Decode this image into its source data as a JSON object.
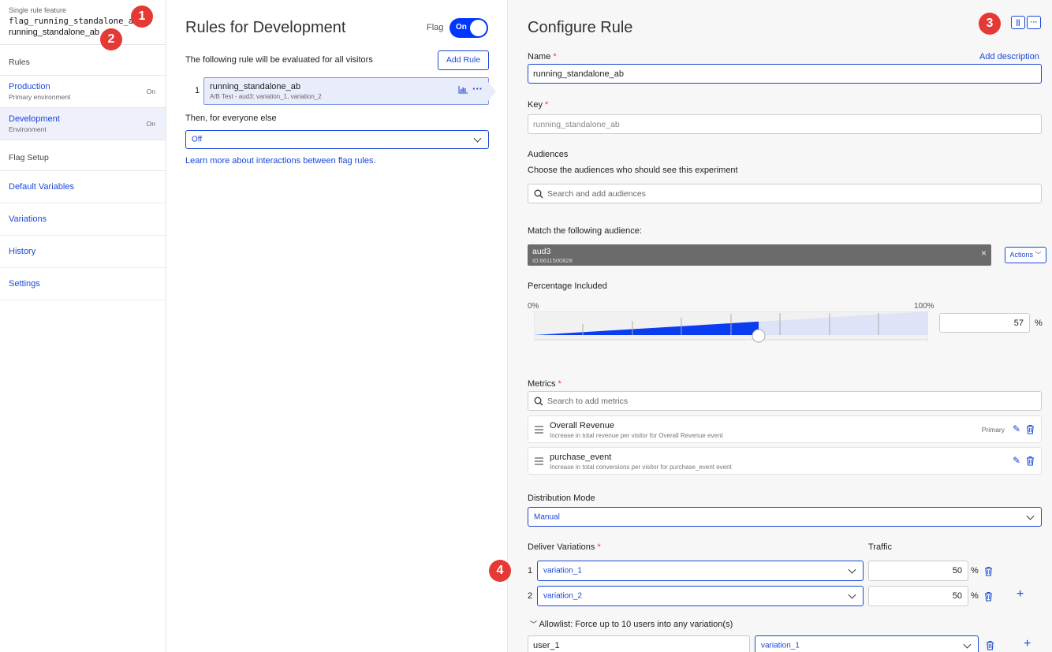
{
  "sidebar": {
    "feature_label": "Single rule feature",
    "flag_key": "flag_running_standalone_ab",
    "rule_name": "running_standalone_ab",
    "rules_heading": "Rules",
    "environments": [
      {
        "name": "Production",
        "sub": "Primary environment",
        "status": "On"
      },
      {
        "name": "Development",
        "sub": "Environment",
        "status": "On"
      }
    ],
    "setup_heading": "Flag Setup",
    "links": [
      "Default Variables",
      "Variations",
      "History",
      "Settings"
    ]
  },
  "badges": [
    "1",
    "2",
    "3",
    "4"
  ],
  "middle": {
    "title": "Rules for Development",
    "flag_label": "Flag",
    "toggle_label": "On",
    "description": "The following rule will be evaluated for all visitors",
    "add_rule": "Add Rule",
    "rule": {
      "index": "1",
      "name": "running_standalone_ab",
      "detail": "A/B Test - aud3: variation_1, variation_2"
    },
    "then_label": "Then, for everyone else",
    "fallback_value": "Off",
    "learn_link": "Learn more about interactions between flag rules."
  },
  "configure": {
    "title": "Configure Rule",
    "name_label": "Name",
    "add_description": "Add description",
    "name_value": "running_standalone_ab",
    "key_label": "Key",
    "key_placeholder": "running_standalone_ab",
    "audiences_label": "Audiences",
    "audiences_help": "Choose the audiences who should see this experiment",
    "audiences_placeholder": "Search and add audiences",
    "match_label": "Match the following audience:",
    "audience": {
      "name": "aud3",
      "id": "ID:6611500828"
    },
    "actions_label": "Actions",
    "percentage_label": "Percentage Included",
    "pct_min": "0%",
    "pct_max": "100%",
    "percentage_value": "57",
    "percentage_fraction": 0.57,
    "percent_sign": "%",
    "metrics_label": "Metrics",
    "metrics_placeholder": "Search to add metrics",
    "metrics": [
      {
        "name": "Overall Revenue",
        "desc": "Increase in total revenue per visitor for Overall Revenue event",
        "tag": "Primary"
      },
      {
        "name": "purchase_event",
        "desc": "Increase in total conversions per visitor for purchase_event event",
        "tag": ""
      }
    ],
    "distribution_label": "Distribution Mode",
    "distribution_value": "Manual",
    "deliver_label": "Deliver Variations",
    "traffic_label": "Traffic",
    "variations": [
      {
        "index": "1",
        "name": "variation_1",
        "traffic": "50"
      },
      {
        "index": "2",
        "name": "variation_2",
        "traffic": "50"
      }
    ],
    "allowlist_label": "Allowlist: Force up to 10 users into any variation(s)",
    "allowlist_user": "user_1",
    "allowlist_variation": "variation_1"
  },
  "colors": {
    "accent": "#1a47d8",
    "toggle": "#0037ff",
    "badge": "#e53935"
  }
}
